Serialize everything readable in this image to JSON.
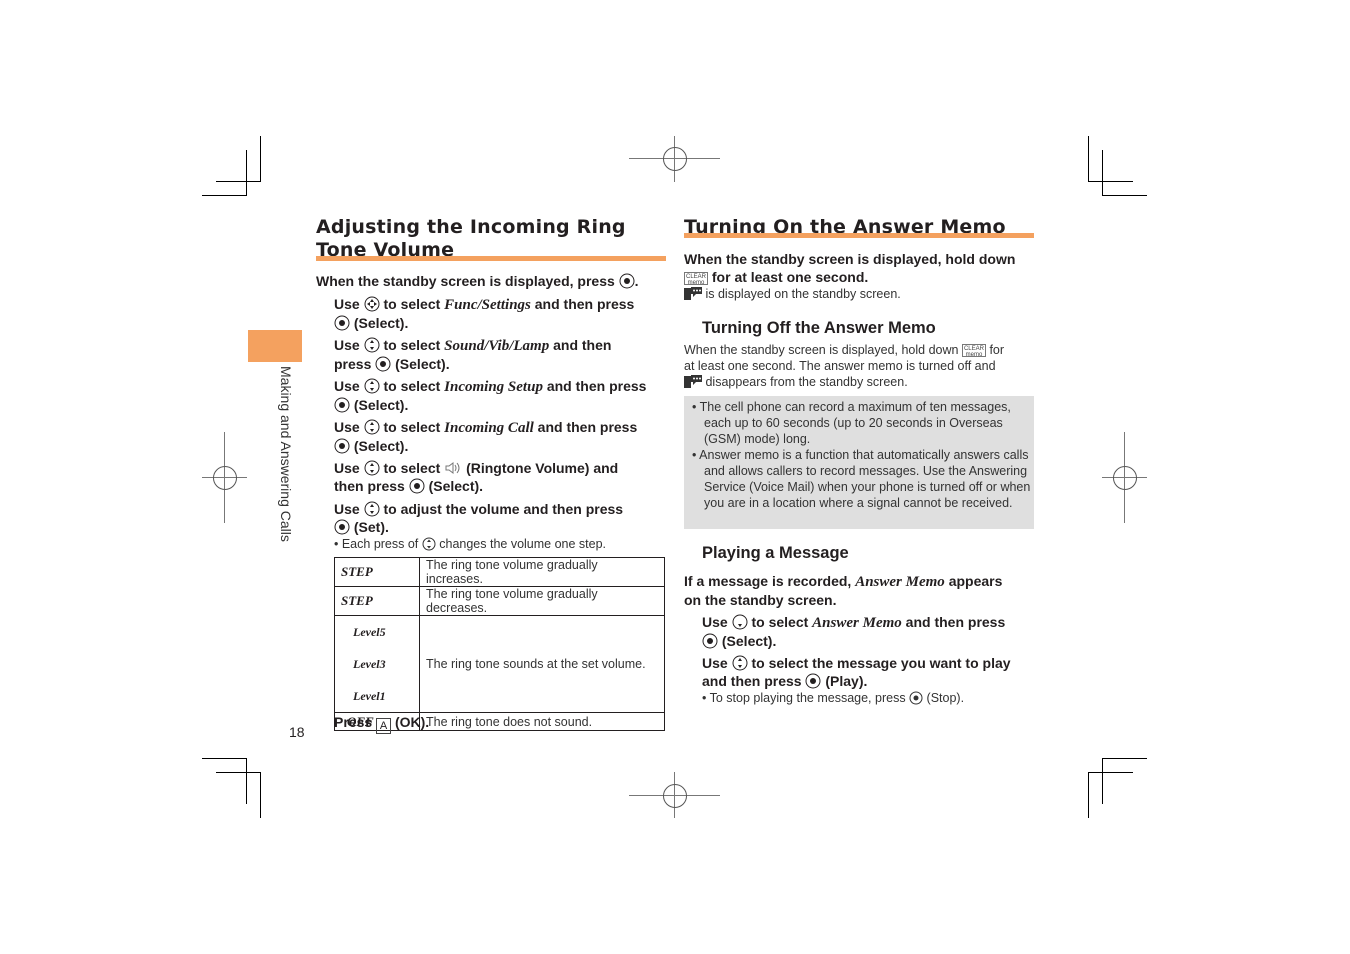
{
  "page_number": "18",
  "side_tab": {
    "label": "Making and Answering Calls",
    "color": "#f4a15f"
  },
  "accent_color": "#f4a15f",
  "left": {
    "title_line1": "Adjusting the Incoming Ring",
    "title_line2": "Tone Volume",
    "intro_pre": "When the standby screen is displayed, press",
    "intro_post": ".",
    "steps": [
      {
        "pre": "Use",
        "mid": "to select",
        "item": "Func/Settings",
        "post": "and then press",
        "end": "(Select)."
      },
      {
        "pre": "Use",
        "mid": "to select",
        "item": "Sound/Vib/Lamp",
        "post": "and then",
        "line2": "press",
        "end": "(Select)."
      },
      {
        "pre": "Use",
        "mid": "to select",
        "item": "Incoming Setup",
        "post": "and then press",
        "end": "(Select)."
      },
      {
        "pre": "Use",
        "mid": "to select",
        "item": "Incoming Call",
        "post": "and then press",
        "end": "(Select)."
      },
      {
        "pre": "Use",
        "mid": "to select",
        "post": "(Ringtone Volume) and",
        "line2": "then press",
        "end": "(Select)."
      },
      {
        "pre": "Use",
        "post": "to adjust the volume and then press",
        "end": "(Set)."
      }
    ],
    "bullet_pre": "• Each press of",
    "bullet_post": "changes the volume one step.",
    "table": [
      {
        "key": "STEP",
        "desc": "The ring tone volume gradually increases."
      },
      {
        "key": "STEP",
        "desc": "The ring tone volume gradually decreases."
      },
      {
        "keys": [
          "Level5",
          "Level3",
          "Level1"
        ],
        "desc": "The ring tone sounds at the set volume."
      },
      {
        "key": "OFF",
        "desc": "The ring tone does not sound."
      }
    ],
    "final_pre": "Press",
    "final_key": "A",
    "final_post": "(OK)."
  },
  "right": {
    "title": "Turning On the Answer Memo",
    "intro_line1": "When the standby screen is displayed, hold down",
    "intro_line2": "for at least one second.",
    "clear_key": [
      "CLEAR",
      "memo"
    ],
    "displayed": "is displayed on the standby screen.",
    "off_title": "Turning Off the Answer Memo",
    "off_l1_pre": "When the standby screen is displayed, hold down",
    "off_l1_post": "for",
    "off_l2": "at least one second. The answer memo is turned off and",
    "off_l3": "disappears from the standby screen.",
    "notes": [
      "The cell phone can record a maximum of ten messages, each up to 60 seconds (up to 20 seconds in Overseas (GSM) mode) long.",
      "Answer memo is a function that automatically answers calls and allows callers to record messages. Use the Answering Service (Voice Mail) when your phone is turned off or when you are in a location where a signal cannot be received."
    ],
    "play_title": "Playing a Message",
    "play_intro_pre": "If a message is recorded,",
    "play_intro_item": "Answer Memo",
    "play_intro_post": "appears",
    "play_intro_l2": "on the standby screen.",
    "play_steps": [
      {
        "pre": "Use",
        "mid": "to select",
        "item": "Answer Memo",
        "post": "and then press",
        "end": "(Select)."
      },
      {
        "pre": "Use",
        "post": "to select the message you want to play",
        "line2": "and then press",
        "end": "(Play)."
      }
    ],
    "stop_pre": "• To stop playing the message, press",
    "stop_post": "(Stop)."
  }
}
